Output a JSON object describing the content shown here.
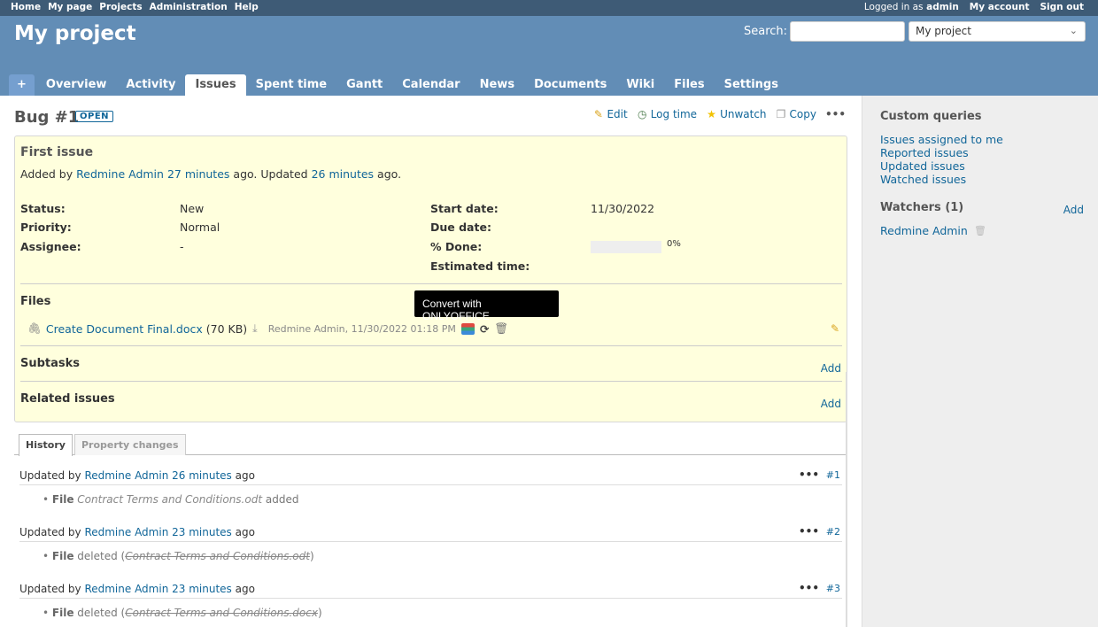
{
  "top_menu": {
    "left": [
      "Home",
      "My page",
      "Projects",
      "Administration",
      "Help"
    ],
    "logged_in_prefix": "Logged in as",
    "logged_in_user": "admin",
    "my_account": "My account",
    "sign_out": "Sign out"
  },
  "header": {
    "project_title": "My project",
    "search_label": "Search:",
    "search_value": "",
    "project_select": "My project"
  },
  "main_menu": {
    "plus": "+",
    "tabs": [
      "Overview",
      "Activity",
      "Issues",
      "Spent time",
      "Gantt",
      "Calendar",
      "News",
      "Documents",
      "Wiki",
      "Files",
      "Settings"
    ],
    "selected": "Issues"
  },
  "issue": {
    "title": "Bug #1",
    "status_badge": "OPEN",
    "actions": {
      "edit": "Edit",
      "log_time": "Log time",
      "unwatch": "Unwatch",
      "copy": "Copy",
      "more": "•••"
    },
    "subject": "First issue",
    "added": {
      "p1": "Added by",
      "author": "Redmine Admin",
      "ago1": "27 minutes",
      "p2": "ago. Updated",
      "ago2": "26 minutes",
      "p3": "ago."
    },
    "attributes": {
      "status_label": "Status:",
      "status": "New",
      "priority_label": "Priority:",
      "priority": "Normal",
      "assignee_label": "Assignee:",
      "assignee": "-",
      "start_label": "Start date:",
      "start": "11/30/2022",
      "due_label": "Due date:",
      "due": "",
      "done_label": "% Done:",
      "done": "0%",
      "done_value": 0,
      "estimated_label": "Estimated time:",
      "estimated": ""
    },
    "files_label": "Files",
    "file": {
      "name": "Create Document Final.docx",
      "size": "(70 KB)",
      "meta": "Redmine Admin, 11/30/2022 01:18 PM"
    },
    "tooltip": "Convert with ONLYOFFICE",
    "subtasks_label": "Subtasks",
    "subtasks_add": "Add",
    "related_label": "Related issues",
    "related_add": "Add"
  },
  "history_tabs": {
    "history": "History",
    "property_changes": "Property changes"
  },
  "journals": [
    {
      "prefix": "Updated by",
      "author": "Redmine Admin",
      "ago": "26 minutes",
      "suffix": "ago",
      "num": "#1",
      "label": "File",
      "file": "Contract Terms and Conditions.odt",
      "action": "added",
      "deleted": false
    },
    {
      "prefix": "Updated by",
      "author": "Redmine Admin",
      "ago": "23 minutes",
      "suffix": "ago",
      "num": "#2",
      "label": "File",
      "action": "deleted",
      "file": "Contract Terms and Conditions.odt",
      "deleted": true
    },
    {
      "prefix": "Updated by",
      "author": "Redmine Admin",
      "ago": "23 minutes",
      "suffix": "ago",
      "num": "#3",
      "label": "File",
      "action": "deleted",
      "file": "Contract Terms and Conditions.docx",
      "deleted": true
    }
  ],
  "sidebar": {
    "custom_queries": "Custom queries",
    "queries": [
      "Issues assigned to me",
      "Reported issues",
      "Updated issues",
      "Watched issues"
    ],
    "watchers": "Watchers (1)",
    "watchers_add": "Add",
    "watcher": "Redmine Admin"
  },
  "colors": {
    "header": "#628db6",
    "top_menu": "#3e5b76",
    "issue_bg": "#ffffdd",
    "link": "#1166aa"
  }
}
